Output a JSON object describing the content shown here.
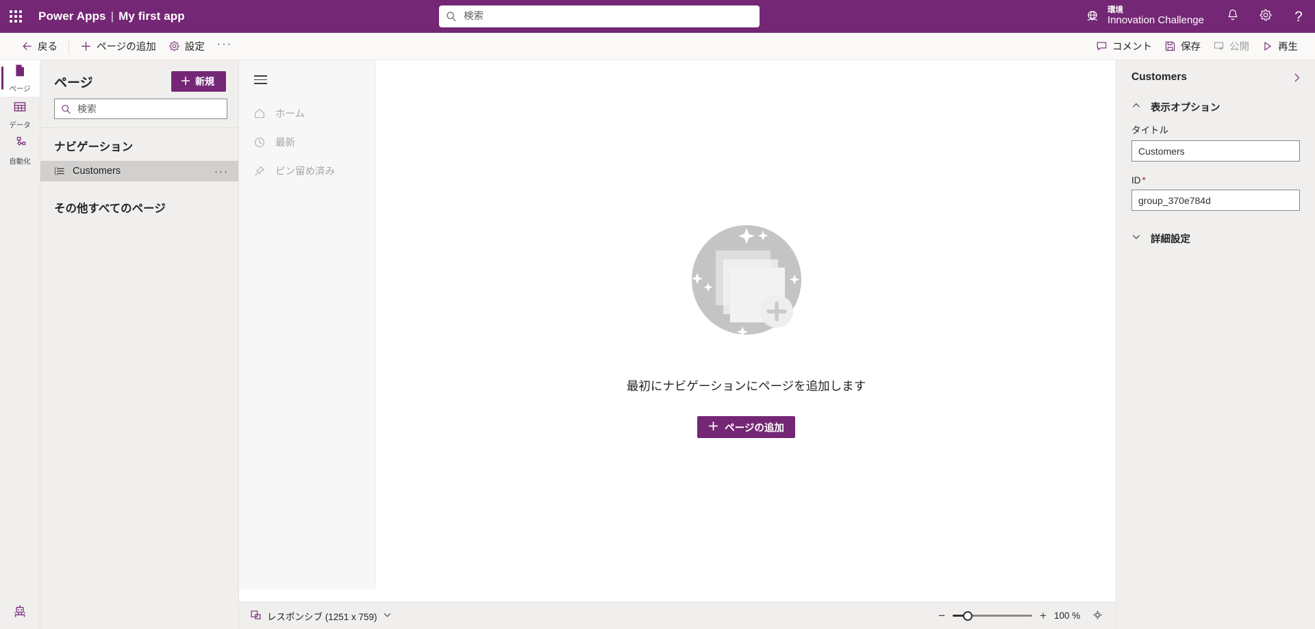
{
  "brand": {
    "app_launcher": "app-launcher",
    "product": "Power Apps",
    "separator": "|",
    "app_name": "My first app"
  },
  "header": {
    "search_placeholder": "検索",
    "environment_label": "環境",
    "environment_name": "Innovation Challenge",
    "notifications": "notifications",
    "settings": "settings",
    "help": "?"
  },
  "commandbar": {
    "back": "戻る",
    "add_page": "ページの追加",
    "settings": "設定",
    "overflow": "···",
    "comment": "コメント",
    "save": "保存",
    "publish": "公開",
    "play": "再生"
  },
  "rail": {
    "items": [
      {
        "label": "ページ",
        "icon": "page-icon",
        "active": true
      },
      {
        "label": "データ",
        "icon": "table-icon",
        "active": false
      },
      {
        "label": "自動化",
        "icon": "automation-icon",
        "active": false
      }
    ],
    "bottom_icon": "copilot-robot-icon"
  },
  "pages_panel": {
    "title": "ページ",
    "new_button": "新規",
    "search_placeholder": "検索",
    "navigation_title": "ナビゲーション",
    "nav_items": [
      {
        "label": "Customers",
        "icon": "list-icon",
        "selected": true,
        "overflow": "···"
      }
    ],
    "other_pages_title": "その他すべてのページ"
  },
  "canvas": {
    "app_nav": {
      "hamburger": "hamburger-icon",
      "items": [
        {
          "label": "ホーム",
          "icon": "home-icon"
        },
        {
          "label": "最新",
          "icon": "clock-icon"
        },
        {
          "label": "ピン留め済み",
          "icon": "pin-icon"
        }
      ]
    },
    "empty_state": {
      "illustration": "add-pages-illustration",
      "message": "最初にナビゲーションにページを追加します",
      "button": "ページの追加"
    }
  },
  "statusbar": {
    "screen_size_label": "レスポンシブ (1251 x 759)",
    "screen_icon": "responsive-icon",
    "chevron": "chevron-down-icon",
    "zoom_out": "−",
    "zoom_in": "+",
    "zoom_value": "100 %",
    "fit_icon": "fit-to-screen-icon"
  },
  "properties": {
    "title": "Customers",
    "collapse_icon": "chevron-right-icon",
    "display_options": {
      "label": "表示オプション",
      "expanded": true
    },
    "title_field": {
      "label": "タイトル",
      "value": "Customers"
    },
    "id_field": {
      "label": "ID",
      "required": "*",
      "value": "group_370e784d"
    },
    "advanced": {
      "label": "詳細設定",
      "expanded": false
    }
  },
  "colors": {
    "brand_purple": "#742774",
    "panel_gray": "#f0efee",
    "canvas_white": "#ffffff",
    "selected_row": "#d2d0ce",
    "required_red": "#a4262c"
  }
}
